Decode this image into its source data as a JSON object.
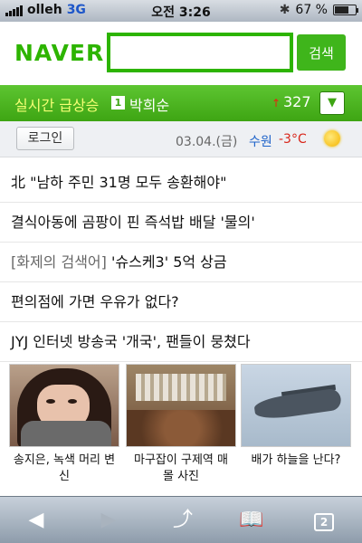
{
  "status_bar": {
    "carrier": "olleh",
    "network": "3G",
    "time": "오전 3:26",
    "battery_percent": "67 %",
    "battery_level": 0.67
  },
  "header": {
    "logo": "NAVER",
    "search_placeholder": "",
    "search_button": "검색",
    "brand_color": "#2db400"
  },
  "realtime": {
    "label": "실시간 급상승",
    "rank": "1",
    "keyword": "박희순",
    "trend_arrow": "↑",
    "count": "327",
    "toggle_icon": "chevron-down-icon"
  },
  "info": {
    "login_label": "로그인",
    "date": "03.04.(금)",
    "city": "수원",
    "temperature": "-3°C",
    "weather_icon": "sun-icon"
  },
  "news": [
    {
      "text": "北 \"남하 주민 31명 모두 송환해야\""
    },
    {
      "text": "결식아동에 곰팡이 핀 즉석밥 배달 '물의'"
    },
    {
      "tag": "[화제의 검색어]",
      "text": " '슈스케3' 5억 상금"
    },
    {
      "text": "편의점에 가면 우유가 없다?"
    },
    {
      "text": "JYJ 인터넷 방송국 '개국', 팬들이 뭉쳤다"
    }
  ],
  "thumbnails": [
    {
      "caption": "송지은, 녹색 머리 변신"
    },
    {
      "caption": "마구잡이 구제역 매몰 사진"
    },
    {
      "caption": "배가 하늘을 난다?"
    }
  ],
  "toolbar": {
    "back_icon": "back-arrow-icon",
    "forward_icon": "forward-arrow-icon",
    "share_icon": "share-icon",
    "bookmarks_icon": "bookmarks-icon",
    "tabs_count": "2"
  }
}
